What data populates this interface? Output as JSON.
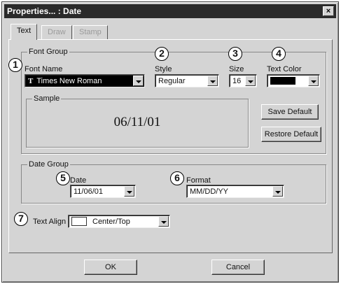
{
  "window": {
    "title": "Properties... : Date",
    "close_label": "×"
  },
  "tabs": [
    {
      "label": "Text",
      "active": true
    },
    {
      "label": "Draw",
      "active": false
    },
    {
      "label": "Stamp",
      "active": false
    }
  ],
  "font_group": {
    "title": "Font Group",
    "font_name": {
      "label": "Font Name",
      "value": "Times New Roman"
    },
    "style": {
      "label": "Style",
      "value": "Regular"
    },
    "size": {
      "label": "Size",
      "value": "16"
    },
    "text_color": {
      "label": "Text Color",
      "color": "#000000"
    },
    "sample": {
      "label": "Sample",
      "text": "06/11/01"
    },
    "save_default": "Save Default",
    "restore_default": "Restore Default"
  },
  "date_group": {
    "title": "Date Group",
    "date": {
      "label": "Date",
      "value": "11/06/01"
    },
    "format": {
      "label": "Format",
      "value": "MM/DD/YY"
    }
  },
  "text_align": {
    "label": "Text Align",
    "value": "Center/Top"
  },
  "buttons": {
    "ok": "OK",
    "cancel": "Cancel"
  },
  "callouts": [
    "1",
    "2",
    "3",
    "4",
    "5",
    "6",
    "7"
  ]
}
